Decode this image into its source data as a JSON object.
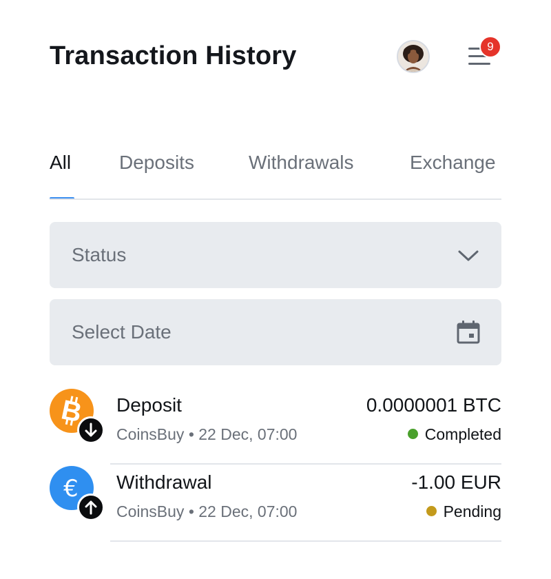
{
  "header": {
    "title": "Transaction History",
    "notification_count": "9"
  },
  "tabs": [
    {
      "label": "All",
      "active": true
    },
    {
      "label": "Deposits",
      "active": false
    },
    {
      "label": "Withdrawals",
      "active": false
    },
    {
      "label": "Exchange",
      "active": false
    }
  ],
  "filters": {
    "status": {
      "label": "Status",
      "icon": "chevron-down-icon"
    },
    "date": {
      "label": "Select Date",
      "icon": "calendar-icon"
    }
  },
  "transactions": [
    {
      "type": "Deposit",
      "source": "CoinsBuy • 22 Dec, 07:00",
      "amount": "0.0000001 BTC",
      "status": "Completed",
      "status_color": "#4aa02c",
      "coin_icon": "bitcoin-icon",
      "coin_color": "#f7931a",
      "direction_icon": "arrow-down-icon"
    },
    {
      "type": "Withdrawal",
      "source": "CoinsBuy • 22 Dec, 07:00",
      "amount": "-1.00 EUR",
      "status": "Pending",
      "status_color": "#c39a1c",
      "coin_icon": "euro-icon",
      "coin_color": "#2f8ff0",
      "direction_icon": "arrow-up-icon"
    }
  ],
  "colors": {
    "accent": "#3b8ef0",
    "badge": "#e5342a",
    "field_bg": "#e8ebef"
  }
}
